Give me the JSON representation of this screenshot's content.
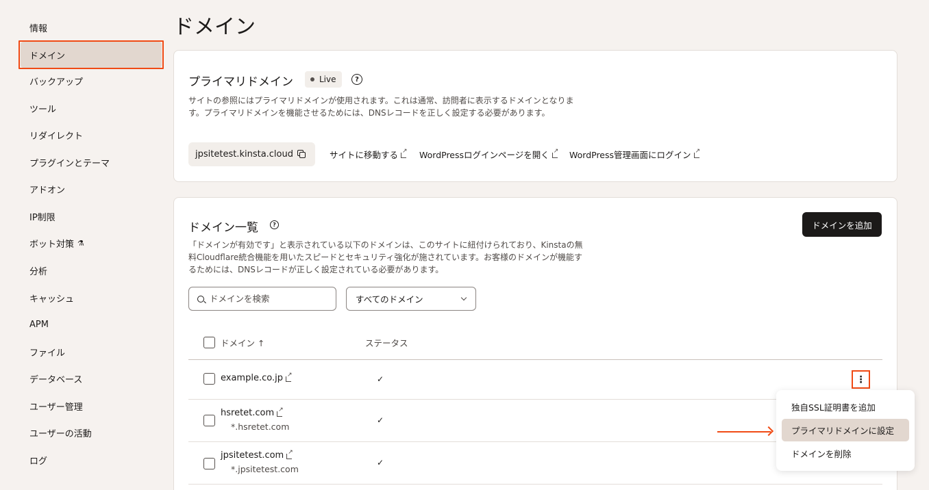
{
  "sidebar": {
    "items": [
      {
        "label": "情報"
      },
      {
        "label": "ドメイン"
      },
      {
        "label": "バックアップ"
      },
      {
        "label": "ツール"
      },
      {
        "label": "リダイレクト"
      },
      {
        "label": "プラグインとテーマ"
      },
      {
        "label": "アドオン"
      },
      {
        "label": "IP制限"
      },
      {
        "label": "ボット対策"
      },
      {
        "label": "分析"
      },
      {
        "label": "キャッシュ"
      },
      {
        "label": "APM"
      },
      {
        "label": "ファイル"
      },
      {
        "label": "データベース"
      },
      {
        "label": "ユーザー管理"
      },
      {
        "label": "ユーザーの活動"
      },
      {
        "label": "ログ"
      }
    ],
    "active_index": 1
  },
  "page": {
    "title": "ドメイン"
  },
  "primary": {
    "title": "プライマリドメイン",
    "badge": "Live",
    "help": "?",
    "description": "サイトの参照にはプライマリドメインが使用されます。これは通常、訪問者に表示するドメインとなります。プライマリドメインを機能させるためには、DNSレコードを正しく設定する必要があります。",
    "domain": "jpsitetest.kinsta.cloud",
    "links": {
      "visit": "サイトに移動する",
      "wp_login": "WordPressログインページを開く",
      "wp_admin": "WordPress管理画面にログイン"
    }
  },
  "list": {
    "title": "ドメイン一覧",
    "help": "?",
    "add_button": "ドメインを追加",
    "description": "「ドメインが有効です」と表示されている以下のドメインは、このサイトに紐付けられており、Kinstaの無料Cloudflare統合機能を用いたスピードとセキュリティ強化が施されています。お客様のドメインが機能するためには、DNSレコードが正しく設定されている必要があります。",
    "search_placeholder": "ドメインを検索",
    "filter_value": "すべてのドメイン",
    "columns": {
      "domain": "ドメイン ↑",
      "status": "ステータス"
    },
    "rows": [
      {
        "domain": "example.co.jp",
        "wildcard": "",
        "status": "✓"
      },
      {
        "domain": "hsretet.com",
        "wildcard": "*.hsretet.com",
        "status": "✓"
      },
      {
        "domain": "jpsitetest.com",
        "wildcard": "*.jpsitetest.com",
        "status": "✓"
      }
    ],
    "kebab": "⋮"
  },
  "menu": {
    "items": [
      {
        "label": "独自SSL証明書を追加"
      },
      {
        "label": "プライマリドメインに設定"
      },
      {
        "label": "ドメインを削除"
      }
    ],
    "hover_index": 1
  },
  "colors": {
    "accent": "#f04a14",
    "active_bg": "#e2d7cf",
    "button_bg": "#1c1a19"
  }
}
